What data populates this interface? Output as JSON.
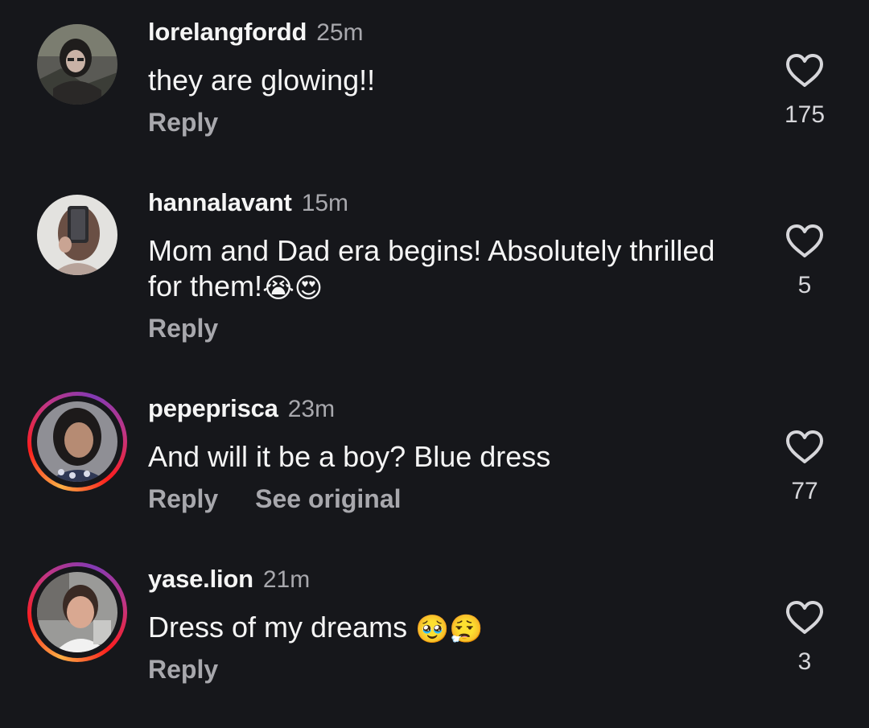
{
  "comments": [
    {
      "username": "lorelangfordd",
      "time": "25m",
      "text": "they are glowing!!",
      "emoji": "",
      "reply_label": "Reply",
      "see_original_label": "",
      "likes": "175",
      "avatar_icon": "user-avatar-photo",
      "has_story_ring": false
    },
    {
      "username": "hannalavant",
      "time": "15m",
      "text": "Mom and Dad era begins! Absolutely thrilled for them!",
      "emoji": "😭😍",
      "reply_label": "Reply",
      "see_original_label": "",
      "likes": "5",
      "avatar_icon": "user-avatar-photo",
      "has_story_ring": false
    },
    {
      "username": "pepeprisca",
      "time": "23m",
      "text": "And will it be a boy? Blue dress",
      "emoji": "",
      "reply_label": "Reply",
      "see_original_label": "See original",
      "likes": "77",
      "avatar_icon": "user-avatar-photo",
      "has_story_ring": true
    },
    {
      "username": "yase.lion",
      "time": "21m",
      "text": "Dress of my dreams ",
      "emoji": "🥹😮‍💨",
      "reply_label": "Reply",
      "see_original_label": "",
      "likes": "3",
      "avatar_icon": "user-avatar-photo",
      "has_story_ring": true
    }
  ],
  "icons": {
    "like": "heart-outline-icon"
  },
  "colors": {
    "background": "#16171b",
    "primary_text": "#f5f5f5",
    "secondary_text": "#a8a8ad",
    "story_ring_gradient": [
      "#fcb045",
      "#fd1d1d",
      "#c13584",
      "#833ab4"
    ]
  }
}
